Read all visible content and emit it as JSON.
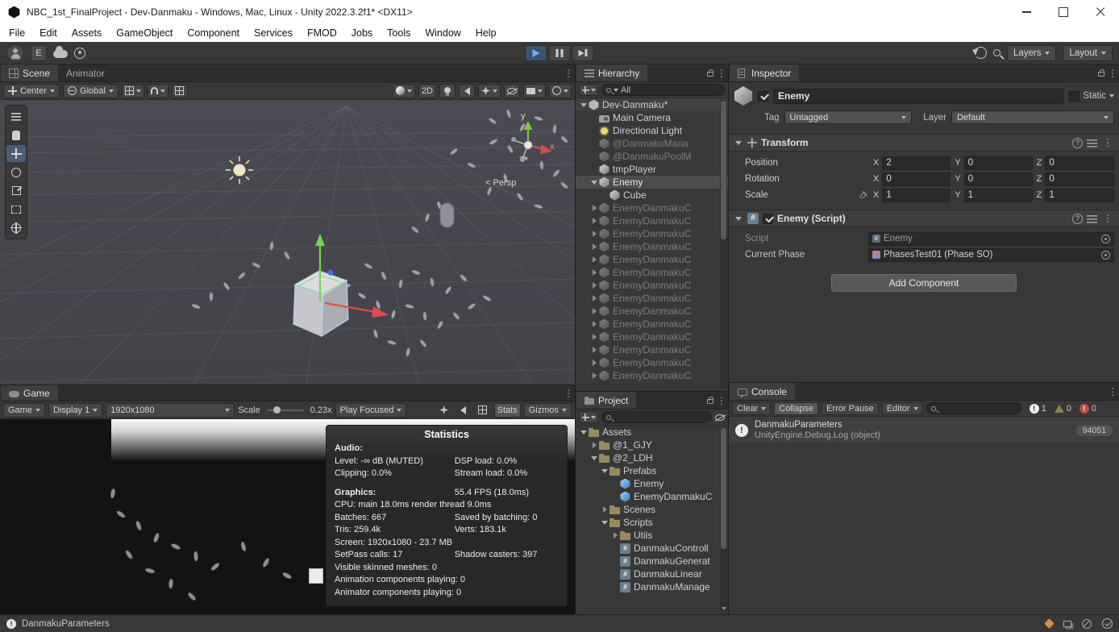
{
  "window": {
    "title": "NBC_1st_FinalProject - Dev-Danmaku - Windows, Mac, Linux - Unity 2022.3.2f1* <DX11>",
    "menus": [
      {
        "label": "File"
      },
      {
        "label": "Edit"
      },
      {
        "label": "Assets"
      },
      {
        "label": "GameObject"
      },
      {
        "label": "Component"
      },
      {
        "label": "Services"
      },
      {
        "label": "FMOD"
      },
      {
        "label": "Jobs"
      },
      {
        "label": "Tools"
      },
      {
        "label": "Window"
      },
      {
        "label": "Help"
      }
    ]
  },
  "toolbar": {
    "account_initial": "E",
    "layers": "Layers",
    "layout": "Layout"
  },
  "scene": {
    "tabs": [
      {
        "label": "Scene"
      },
      {
        "label": "Animator"
      }
    ],
    "handle": "Center",
    "orientation": "Global",
    "two_d": "2D",
    "gizmo_y": "y",
    "gizmo_x": "x",
    "persp": "< Persp"
  },
  "game": {
    "tab": "Game",
    "mode": "Game",
    "display": "Display 1",
    "resolution": "1920x1080",
    "scale_label": "Scale",
    "scale_value": "0.23x",
    "focus": "Play Focused",
    "stats_button": "Stats",
    "gizmos_button": "Gizmos",
    "stats": {
      "title": "Statistics",
      "rows": [
        {
          "l": "Audio:",
          "s": "hdr"
        },
        {
          "l": "Level: -∞ dB (MUTED)",
          "r": "DSP load: 0.0%"
        },
        {
          "l": "Clipping: 0.0%",
          "r": "Stream load: 0.0%"
        },
        {
          "l": "Graphics:",
          "r": "55.4 FPS (18.0ms)",
          "s": "hdr gap"
        },
        {
          "l": "CPU: main 18.0ms  render thread 9.0ms"
        },
        {
          "l": "Batches: 667",
          "r": "Saved by batching: 0"
        },
        {
          "l": "Tris: 259.4k",
          "r": "Verts: 183.1k"
        },
        {
          "l": "Screen: 1920x1080 - 23.7 MB"
        },
        {
          "l": "SetPass calls: 17",
          "r": "Shadow casters: 397"
        },
        {
          "l": "Visible skinned meshes: 0"
        },
        {
          "l": "Animation components playing: 0"
        },
        {
          "l": "Animator components playing: 0"
        }
      ]
    }
  },
  "hierarchy": {
    "tab": "Hierarchy",
    "search": "All",
    "items": [
      {
        "label": "Dev-Danmaku*",
        "s": "d0 a-down ico-unity root"
      },
      {
        "label": "Main Camera",
        "s": "d1 ico-cam"
      },
      {
        "label": "Directional Light",
        "s": "d1 ico-light"
      },
      {
        "label": "@DanmakuMana",
        "s": "d1 ico-go dim"
      },
      {
        "label": "@DanmakuPoolM",
        "s": "d1 ico-go dim"
      },
      {
        "label": "tmpPlayer",
        "s": "d1 ico-go"
      },
      {
        "label": "Enemy",
        "s": "d1 a-down ico-go sel"
      },
      {
        "label": "Cube",
        "s": "d2 ico-go"
      },
      {
        "label": "EnemyDanmakuC",
        "s": "d1 a-right ico-go dim"
      },
      {
        "label": "EnemyDanmakuC",
        "s": "d1 a-right ico-go dim"
      },
      {
        "label": "EnemyDanmakuC",
        "s": "d1 a-right ico-go dim"
      },
      {
        "label": "EnemyDanmakuC",
        "s": "d1 a-right ico-go dim"
      },
      {
        "label": "EnemyDanmakuC",
        "s": "d1 a-right ico-go dim"
      },
      {
        "label": "EnemyDanmakuC",
        "s": "d1 a-right ico-go dim"
      },
      {
        "label": "EnemyDanmakuC",
        "s": "d1 a-right ico-go dim"
      },
      {
        "label": "EnemyDanmakuC",
        "s": "d1 a-right ico-go dim"
      },
      {
        "label": "EnemyDanmakuC",
        "s": "d1 a-right ico-go dim"
      },
      {
        "label": "EnemyDanmakuC",
        "s": "d1 a-right ico-go dim"
      },
      {
        "label": "EnemyDanmakuC",
        "s": "d1 a-right ico-go dim"
      },
      {
        "label": "EnemyDanmakuC",
        "s": "d1 a-right ico-go dim"
      },
      {
        "label": "EnemyDanmakuC",
        "s": "d1 a-right ico-go dim"
      },
      {
        "label": "EnemyDanmakuC",
        "s": "d1 a-right ico-go dim"
      }
    ]
  },
  "project": {
    "tab": "Project",
    "items": [
      {
        "label": "Assets",
        "s": "d0 a-down ico-folder"
      },
      {
        "label": "@1_GJY",
        "s": "d1 a-right ico-folder"
      },
      {
        "label": "@2_LDH",
        "s": "d1 a-down ico-folder"
      },
      {
        "label": "Prefabs",
        "s": "d2 a-down ico-folder"
      },
      {
        "label": "Enemy",
        "s": "d3 ico-prefab"
      },
      {
        "label": "EnemyDanmakuC",
        "s": "d3 ico-prefab"
      },
      {
        "label": "Scenes",
        "s": "d2 a-right ico-folder"
      },
      {
        "label": "Scripts",
        "s": "d2 a-down ico-folder"
      },
      {
        "label": "Utils",
        "s": "d3 a-right ico-folder"
      },
      {
        "label": "DanmakuControll",
        "s": "d3 ico-cs"
      },
      {
        "label": "DanmakuGenerat",
        "s": "d3 ico-cs"
      },
      {
        "label": "DanmakuLinear",
        "s": "d3 ico-cs"
      },
      {
        "label": "DanmakuManage",
        "s": "d3 ico-cs"
      }
    ]
  },
  "inspector": {
    "tab": "Inspector",
    "name": "Enemy",
    "static_label": "Static",
    "tag_label": "Tag",
    "tag_value": "Untagged",
    "layer_label": "Layer",
    "layer_value": "Default",
    "axes": [
      "X",
      "Y",
      "Z"
    ],
    "transform": {
      "title": "Transform",
      "rows": [
        {
          "label": "Position",
          "x": "2",
          "y": "0",
          "z": "0"
        },
        {
          "label": "Rotation",
          "x": "0",
          "y": "0",
          "z": "0"
        },
        {
          "label": "Scale",
          "x": "1",
          "y": "1",
          "z": "1"
        }
      ]
    },
    "script": {
      "title": "Enemy (Script)",
      "script_label": "Script",
      "script_value": "Enemy",
      "phase_label": "Current Phase",
      "phase_value": "PhasesTest01 (Phase SO)"
    },
    "add_component": "Add Component"
  },
  "console": {
    "tab": "Console",
    "clear": "Clear",
    "collapse": "Collapse",
    "error_pause": "Error Pause",
    "editor": "Editor",
    "info_count": "1",
    "warn_count": "0",
    "error_count": "0",
    "entry": {
      "line1": "DanmakuParameters",
      "line2": "UnityEngine.Debug.Log (object)",
      "count": "94051"
    }
  },
  "status": {
    "message": "DanmakuParameters"
  }
}
